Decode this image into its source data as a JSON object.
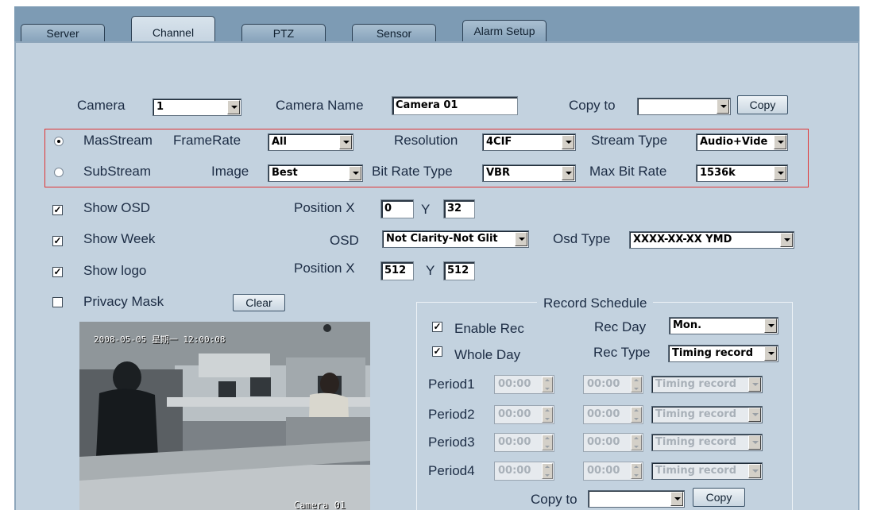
{
  "tabs": [
    {
      "label": "Server",
      "active": false
    },
    {
      "label": "Channel",
      "active": true
    },
    {
      "label": "PTZ",
      "active": false
    },
    {
      "label": "Sensor",
      "active": false
    },
    {
      "label": "Alarm Setup",
      "active": false
    }
  ],
  "camera": {
    "label": "Camera",
    "value": "1"
  },
  "camera_name": {
    "label": "Camera Name",
    "value": "Camera 01"
  },
  "copy_to": {
    "label": "Copy to",
    "value": "",
    "button": "Copy"
  },
  "stream": {
    "main_label": "MasStream",
    "sub_label": "SubStream",
    "selected": "MasStream",
    "framerate": {
      "label": "FrameRate",
      "value": "All"
    },
    "image": {
      "label": "Image",
      "value": "Best"
    },
    "resolution": {
      "label": "Resolution",
      "value": "4CIF"
    },
    "bitrate_type": {
      "label": "Bit Rate Type",
      "value": "VBR"
    },
    "stream_type": {
      "label": "Stream Type",
      "value": "Audio+Vide"
    },
    "max_bitrate": {
      "label": "Max Bit Rate",
      "value": "1536k"
    }
  },
  "osd": {
    "show_osd": {
      "label": "Show OSD",
      "checked": true
    },
    "show_week": {
      "label": "Show Week",
      "checked": true
    },
    "show_logo": {
      "label": "Show logo",
      "checked": true
    },
    "privacy_mask": {
      "label": "Privacy Mask",
      "checked": false
    },
    "clear_button": "Clear",
    "position_label": "Position X",
    "y_label": "Y",
    "osd_pos": {
      "x": "0",
      "y": "32"
    },
    "logo_pos": {
      "x": "512",
      "y": "512"
    },
    "osd_mode": {
      "label": "OSD",
      "value": "Not Clarity-Not Glit"
    },
    "osd_type": {
      "label": "Osd Type",
      "value": "XXXX-XX-XX YMD"
    }
  },
  "preview": {
    "timestamp": "2008-05-05 星期一 12:00:08",
    "camera_label": "Camera 01"
  },
  "record_schedule": {
    "title": "Record Schedule",
    "enable_rec": {
      "label": "Enable Rec",
      "checked": true
    },
    "whole_day": {
      "label": "Whole Day",
      "checked": true
    },
    "rec_day": {
      "label": "Rec Day",
      "value": "Mon."
    },
    "rec_type": {
      "label": "Rec Type",
      "value": "Timing record"
    },
    "periods": [
      {
        "label": "Period1",
        "start": "00:00",
        "end": "00:00",
        "type": "Timing record"
      },
      {
        "label": "Period2",
        "start": "00:00",
        "end": "00:00",
        "type": "Timing record"
      },
      {
        "label": "Period3",
        "start": "00:00",
        "end": "00:00",
        "type": "Timing record"
      },
      {
        "label": "Period4",
        "start": "00:00",
        "end": "00:00",
        "type": "Timing record"
      }
    ],
    "copy_to": {
      "label": "Copy to",
      "value": "",
      "button": "Copy"
    }
  },
  "colors": {
    "panel": "#c3d2df",
    "tabstrip": "#7d9bb4",
    "highlight_box": "#e03434"
  }
}
